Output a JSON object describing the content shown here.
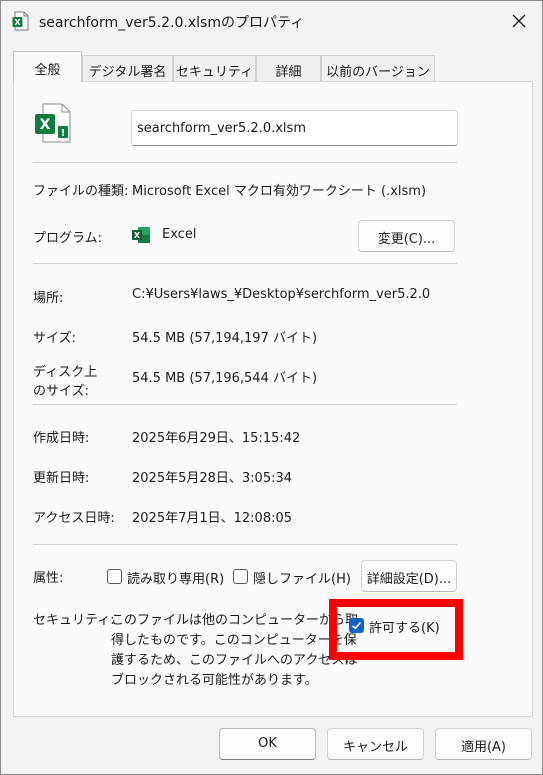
{
  "window": {
    "title": "searchform_ver5.2.0.xlsmのプロパティ",
    "close_glyph": "✕"
  },
  "tabs": [
    {
      "label": "全般",
      "active": true
    },
    {
      "label": "デジタル署名",
      "active": false
    },
    {
      "label": "セキュリティ",
      "active": false
    },
    {
      "label": "詳細",
      "active": false
    },
    {
      "label": "以前のバージョン",
      "active": false
    }
  ],
  "file": {
    "name": "searchform_ver5.2.0.xlsm",
    "type_label": "ファイルの種類:",
    "type_value": "Microsoft Excel マクロ有効ワークシート (.xlsm)",
    "program_label": "プログラム:",
    "program_value": "Excel",
    "change_button": "変更(C)..."
  },
  "location": {
    "label": "場所:",
    "value": "C:¥Users¥laws_¥Desktop¥serchform_ver5.2.0"
  },
  "size": {
    "label": "サイズ:",
    "value": "54.5 MB (57,194,197 バイト)",
    "disk_label_line1": "ディスク上",
    "disk_label_line2": "のサイズ:",
    "disk_value": "54.5 MB (57,196,544 バイト)"
  },
  "dates": {
    "created_label": "作成日時:",
    "created_value": "2025年6月29日、15:15:42",
    "modified_label": "更新日時:",
    "modified_value": "2025年5月28日、3:05:34",
    "accessed_label": "アクセス日時:",
    "accessed_value": "2025年7月1日、12:08:05"
  },
  "attributes": {
    "label": "属性:",
    "readonly_label": "読み取り専用(R)",
    "readonly_checked": false,
    "hidden_label": "隠しファイル(H)",
    "hidden_checked": false,
    "advanced_button": "詳細設定(D)..."
  },
  "security": {
    "label": "セキュリティ:",
    "text_line1": "このファイルは他のコンピューターから取",
    "text_line2": "得したものです。このコンピューターを保",
    "text_line3": "護するため、このファイルへのアクセスは",
    "text_line4": "ブロックされる可能性があります。",
    "unblock_label": "許可する(K)",
    "unblock_checked": true,
    "highlight_color": "#ff0000"
  },
  "buttons": {
    "ok": "OK",
    "cancel": "キャンセル",
    "apply": "適用(A)"
  },
  "colors": {
    "excel_green": "#107c41",
    "checkbox_blue": "#1463c4"
  }
}
